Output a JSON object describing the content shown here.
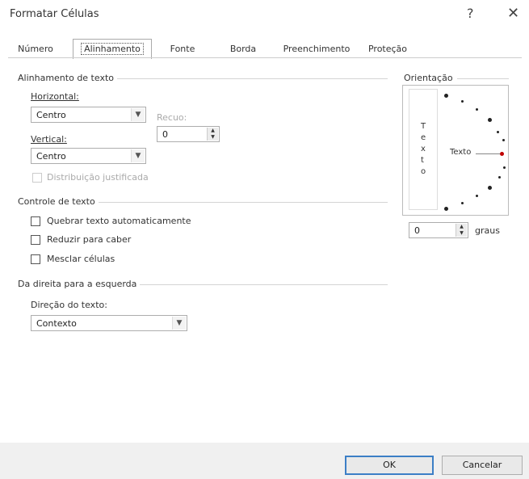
{
  "window": {
    "title": "Formatar Células",
    "help": "?",
    "close": "✕"
  },
  "tabs": [
    "Número",
    "Alinhamento",
    "Fonte",
    "Borda",
    "Preenchimento",
    "Proteção"
  ],
  "active_tab": "Alinhamento",
  "alignment": {
    "group_label": "Alinhamento de texto",
    "horizontal_label": "Horizontal:",
    "horizontal_value": "Centro",
    "indent_label": "Recuo:",
    "indent_value": "0",
    "vertical_label": "Vertical:",
    "vertical_value": "Centro",
    "justified_label": "Distribuição justificada"
  },
  "text_control": {
    "group_label": "Controle de texto",
    "wrap_label": "Quebrar texto automaticamente",
    "shrink_label": "Reduzir para caber",
    "merge_label": "Mesclar células"
  },
  "rtl": {
    "group_label": "Da direita para a esquerda",
    "direction_label": "Direção do texto:",
    "direction_value": "Contexto"
  },
  "orientation": {
    "group_label": "Orientação",
    "vertical_letters": [
      "T",
      "e",
      "x",
      "t",
      "o"
    ],
    "text_label": "Texto",
    "degrees_value": "0",
    "degrees_label": "graus",
    "accent_color": "#c00000"
  },
  "footer": {
    "ok_label": "OK",
    "cancel_label": "Cancelar"
  }
}
